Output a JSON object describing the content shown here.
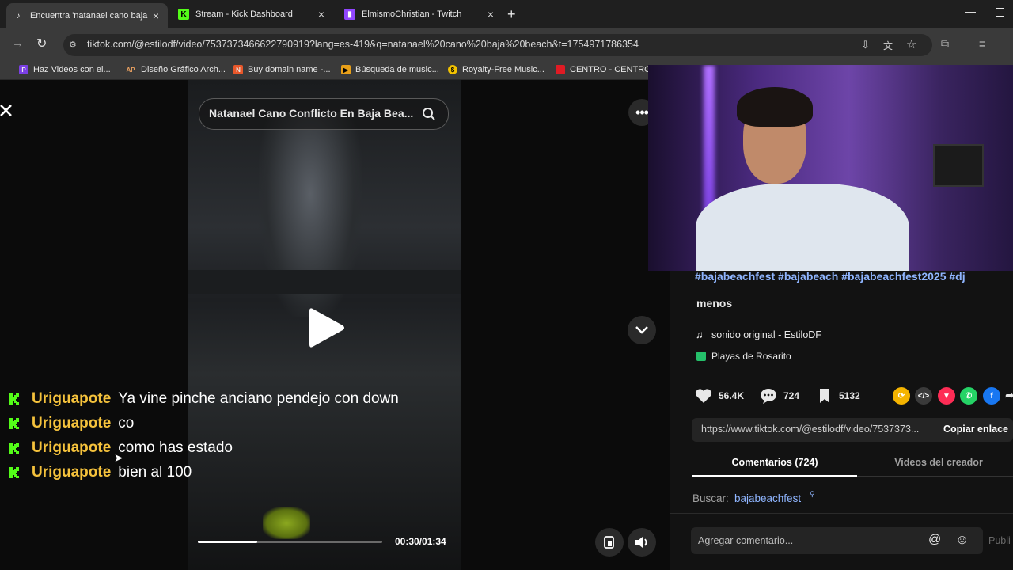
{
  "tabs": [
    {
      "label": "Encuentra 'natanael cano baja b",
      "icon": "tiktok-icon",
      "active": true
    },
    {
      "label": "Stream - Kick Dashboard",
      "icon": "kick-icon",
      "active": false
    },
    {
      "label": "ElmismoChristian - Twitch",
      "icon": "twitch-icon",
      "active": false
    }
  ],
  "address": {
    "url": "tiktok.com/@estilodf/video/7537373466622790919?lang=es-419&q=natanael%20cano%20baja%20beach&t=1754971786354"
  },
  "bookmarks": [
    {
      "label": "Haz Videos con el...",
      "icon_text": "P",
      "color": "#7b3fe4"
    },
    {
      "label": "Diseño Gráfico Arch...",
      "icon_text": "AP",
      "color": "#3a3a3a"
    },
    {
      "label": "Buy domain name -...",
      "icon_text": "N",
      "color": "#e8572a"
    },
    {
      "label": "Búsqueda de music...",
      "icon_text": "▶",
      "color": "#e8a019"
    },
    {
      "label": "Royalty-Free Music...",
      "icon_text": "$",
      "color": "#f2c200"
    },
    {
      "label": "CENTRO - CENTRO,...",
      "icon_text": "",
      "color": "#e01b24"
    }
  ],
  "video": {
    "search_text": "Natanael Cano Conflicto En Baja Bea...",
    "time": "00:30/01:34",
    "progress": 0.32
  },
  "chat": [
    {
      "user": "Uriguapote",
      "message": "Ya vine pinche anciano pendejo con down"
    },
    {
      "user": "Uriguapote",
      "message": "co"
    },
    {
      "user": "Uriguapote",
      "message": "como has estado"
    },
    {
      "user": "Uriguapote",
      "message": "bien al 100"
    }
  ],
  "details": {
    "hashtags": "#bajabeachfest #bajabeach #bajabeachfest2025 #dj",
    "less": "menos",
    "sound": "sonido original - EstiloDF",
    "location": "Playas de Rosarito",
    "likes": "56.4K",
    "comments": "724",
    "saves": "5132",
    "link": "https://www.tiktok.com/@estilodf/video/7537373...",
    "copy_label": "Copiar enlace",
    "tab_comments": "Comentarios (724)",
    "tab_creator": "Videos del creador",
    "search_label": "Buscar:",
    "search_term": "bajabeachfest",
    "comment_placeholder": "Agregar comentario...",
    "post_label": "Publi"
  },
  "colors": {
    "accent": "#8fb5ff",
    "chat_user": "#f5c23c",
    "kick_green": "#53fc18"
  }
}
